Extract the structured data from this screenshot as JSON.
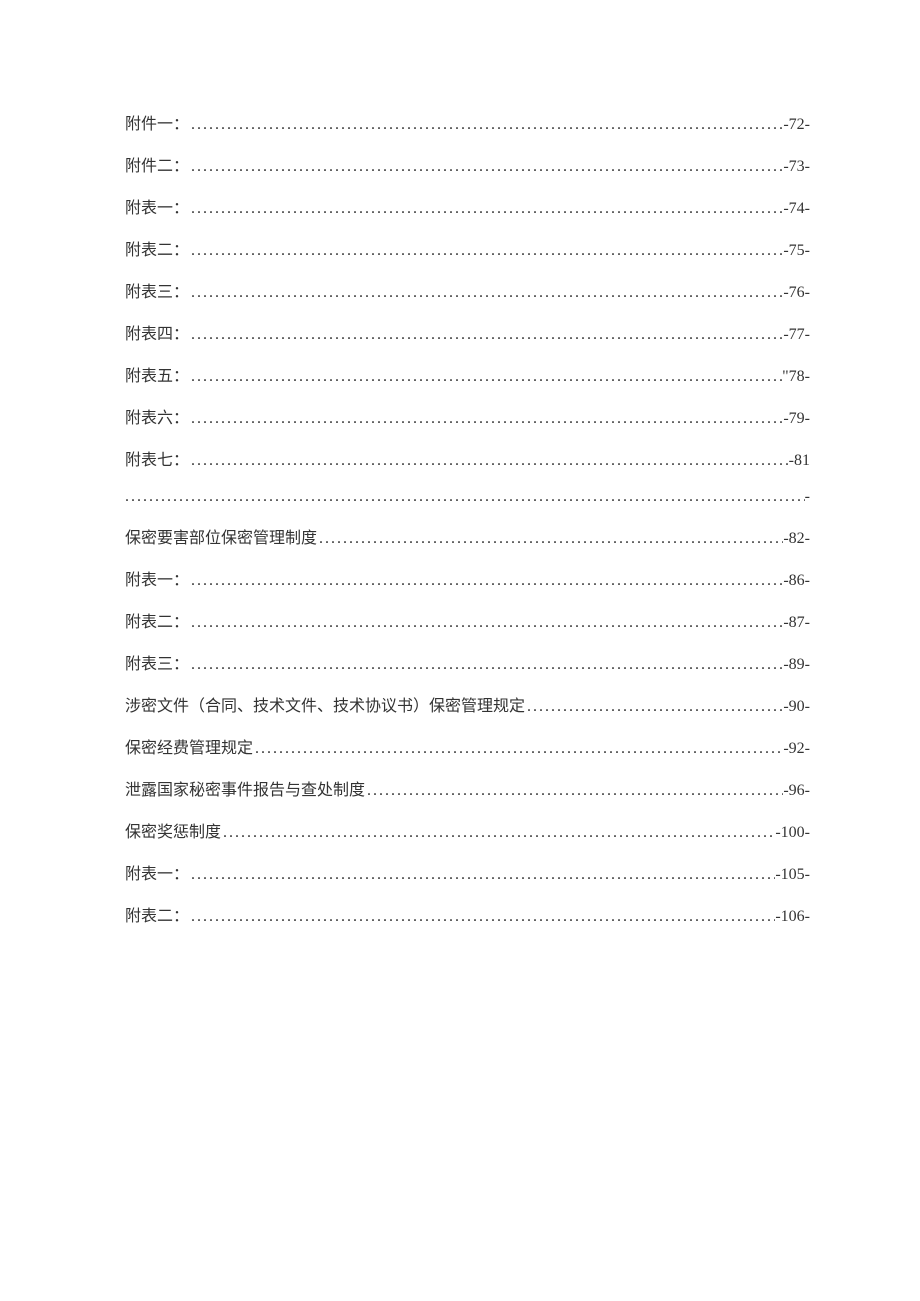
{
  "toc": {
    "entries": [
      {
        "label": "附件一：",
        "page": "-72-"
      },
      {
        "label": "附件二：",
        "page": "-73-"
      },
      {
        "label": "附表一：",
        "page": "-74-"
      },
      {
        "label": "附表二：",
        "page": "-75-"
      },
      {
        "label": "附表三：",
        "page": "-76-"
      },
      {
        "label": "附表四：",
        "page": "-77-"
      },
      {
        "label": "附表五：",
        "page": "\"78-"
      },
      {
        "label": "附表六：",
        "page": "-79-"
      },
      {
        "label": "附表七：",
        "page": "-81",
        "continuation_tail": "-"
      },
      {
        "label": "保密要害部位保密管理制度",
        "page": "-82-"
      },
      {
        "label": "附表一：",
        "page": "-86-"
      },
      {
        "label": "附表二：",
        "page": "-87-"
      },
      {
        "label": "附表三：",
        "page": "-89-"
      },
      {
        "label": "涉密文件（合同、技术文件、技术协议书）保密管理规定",
        "page": "-90-"
      },
      {
        "label": "保密经费管理规定",
        "page": "-92-"
      },
      {
        "label": "泄露国家秘密事件报告与查处制度",
        "page": "-96-"
      },
      {
        "label": "保密奖惩制度",
        "page": "-100-"
      },
      {
        "label": "附表一：",
        "page": "-105-"
      },
      {
        "label": "附表二：",
        "page": "-106-"
      }
    ]
  }
}
